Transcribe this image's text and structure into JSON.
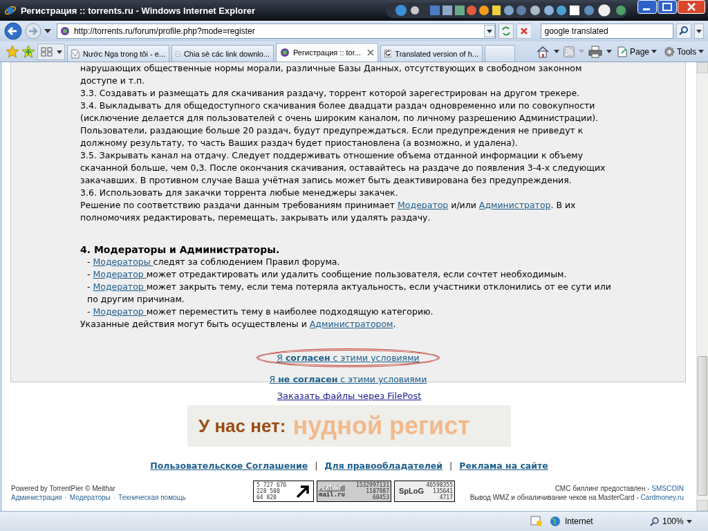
{
  "window": {
    "title": "Регистрация :: torrents.ru - Windows Internet Explorer"
  },
  "address_bar": {
    "url": "http://torrents.ru/forum/profile.php?mode=register"
  },
  "search": {
    "value": "google translated"
  },
  "tabs": [
    {
      "label": "Nước Nga trong tôi - e...",
      "selected": false,
      "kind": "page"
    },
    {
      "label": "Chia sè các link downlo...",
      "selected": false,
      "kind": "page"
    },
    {
      "label": "Регистрация :: tor...",
      "selected": true,
      "kind": "site"
    },
    {
      "label": "Translated version of h...",
      "selected": false,
      "kind": "google"
    }
  ],
  "command_bar": {
    "page": "Page",
    "tools": "Tools"
  },
  "content": [
    {
      "kind": "paragraph",
      "segments": [
        {
          "kind": "text",
          "text": "нарушающих общественные нормы морали, различные Базы Данных, отсутствующих в свободном законном доступе и т.п."
        }
      ]
    },
    {
      "kind": "paragraph",
      "segments": [
        {
          "kind": "text",
          "text": "3.3. Создавать и размещать для скачивания раздачу, торрент которой зарегестрирован на другом трекере."
        }
      ]
    },
    {
      "kind": "paragraph",
      "segments": [
        {
          "kind": "text",
          "text": "3.4. Выкладывать для общедоступного скачивания более двадцати раздач одновременно или по совокупности (исключение делается для пользователей с очень широким каналом, по личному разрешению Администрации)."
        }
      ]
    },
    {
      "kind": "paragraph",
      "segments": [
        {
          "kind": "text",
          "text": "Пользователи, раздающие больше 20 раздач, будут предупреждаться. Если предупреждения не приведут к должному результату, то часть Ваших раздач будет приостановлена (а возможно, и удалена)."
        }
      ]
    },
    {
      "kind": "paragraph",
      "segments": [
        {
          "kind": "text",
          "text": "3.5. Закрывать канал на отдачу. Следует поддерживать отношение объема отданной информации к объему скачанной больше, чем 0,3. После окончания скачивания, оставайтесь на раздаче до появления 3-4-х следующих закачавших. В противном случае Ваша учётная запись может быть деактивирована без предупреждения."
        }
      ]
    },
    {
      "kind": "paragraph",
      "segments": [
        {
          "kind": "text",
          "text": "3.6. Использовать для закачки торрента любые менеджеры закачек."
        }
      ]
    },
    {
      "kind": "paragraph",
      "segments": [
        {
          "kind": "text",
          "text": "Решение по соответствию раздачи данным требованиям принимает "
        },
        {
          "kind": "link",
          "text": "Модератор"
        },
        {
          "kind": "text",
          "text": " и/или "
        },
        {
          "kind": "link",
          "text": "Администратор"
        },
        {
          "kind": "text",
          "text": ". В их полномочиях редактировать, перемещать, закрывать или удалять раздачу."
        }
      ]
    },
    {
      "kind": "heading",
      "segments": [
        {
          "kind": "text",
          "text": "4. Модераторы и Администраторы."
        }
      ]
    },
    {
      "kind": "item",
      "segments": [
        {
          "kind": "text",
          "text": "- "
        },
        {
          "kind": "link",
          "text": "Модераторы "
        },
        {
          "kind": "text",
          "text": "следят за соблюдением Правил форума."
        }
      ]
    },
    {
      "kind": "item",
      "segments": [
        {
          "kind": "text",
          "text": "- "
        },
        {
          "kind": "link",
          "text": "Модератор "
        },
        {
          "kind": "text",
          "text": "может отредактировать или удалить сообщение пользователя, если сочтет необходимым."
        }
      ]
    },
    {
      "kind": "item",
      "segments": [
        {
          "kind": "text",
          "text": "- "
        },
        {
          "kind": "link",
          "text": "Модератор "
        },
        {
          "kind": "text",
          "text": "может закрыть тему, если тема потеряла актуальность, если участники отклонились от ее сути или по другим причинам."
        }
      ]
    },
    {
      "kind": "item",
      "segments": [
        {
          "kind": "text",
          "text": "- "
        },
        {
          "kind": "link",
          "text": "Модератор "
        },
        {
          "kind": "text",
          "text": "может переместить тему в наиболее подходящую категорию."
        }
      ]
    },
    {
      "kind": "paragraph",
      "segments": [
        {
          "kind": "text",
          "text": "Указанные действия могут быть осуществлены и "
        },
        {
          "kind": "link",
          "text": "Администратором"
        },
        {
          "kind": "text",
          "text": "."
        }
      ]
    }
  ],
  "agree_links": [
    {
      "text": "Я **согласен** с этими условиями",
      "circled": true
    },
    {
      "text": "Я **не согласен** с этими условиями",
      "circled": false
    }
  ],
  "filepost_link": "Заказать файлы через FilePost",
  "banner": {
    "text": "У нас нет:",
    "faded_text": "нудной регист"
  },
  "footer_links": [
    {
      "kind": "link",
      "text": "Пользовательское Соглашение"
    },
    {
      "kind": "separator",
      "text": "|"
    },
    {
      "kind": "link",
      "text": "Для правообладателей"
    },
    {
      "kind": "separator",
      "text": "|"
    },
    {
      "kind": "link",
      "text": "Реклама на сайте"
    }
  ],
  "powered_by": "Powered by TorrentPier © Meithar",
  "admin_links": [
    {
      "kind": "link",
      "text": "Администрация"
    },
    {
      "kind": "separator",
      "text": "·"
    },
    {
      "kind": "link",
      "text": "Модераторы"
    },
    {
      "kind": "separator",
      "text": "·"
    },
    {
      "kind": "link",
      "text": "Техническая помощь"
    }
  ],
  "counters": [
    {
      "kind": "arrow",
      "lines": [
        "5 727 676",
        "228 500",
        "64 820"
      ]
    },
    {
      "kind": "mailru",
      "top": "РЕЙТИНГ",
      "logo": "mail.ru",
      "lines": [
        "1532997131",
        "1107987",
        "60453"
      ]
    },
    {
      "kind": "spylog",
      "logo": "SpLoG",
      "lines": [
        "46598355",
        "135641",
        "4717"
      ]
    }
  ],
  "billing": [
    {
      "text": "СМС биллинг предоставлен - ",
      "link": "SMSCOIN"
    },
    {
      "text": "Вывод WMZ и обналичивание чеков на MasterCard - ",
      "link": "Cardmoney.ru"
    }
  ],
  "status_bar": {
    "zone": "Internet",
    "zoom": "100%"
  }
}
